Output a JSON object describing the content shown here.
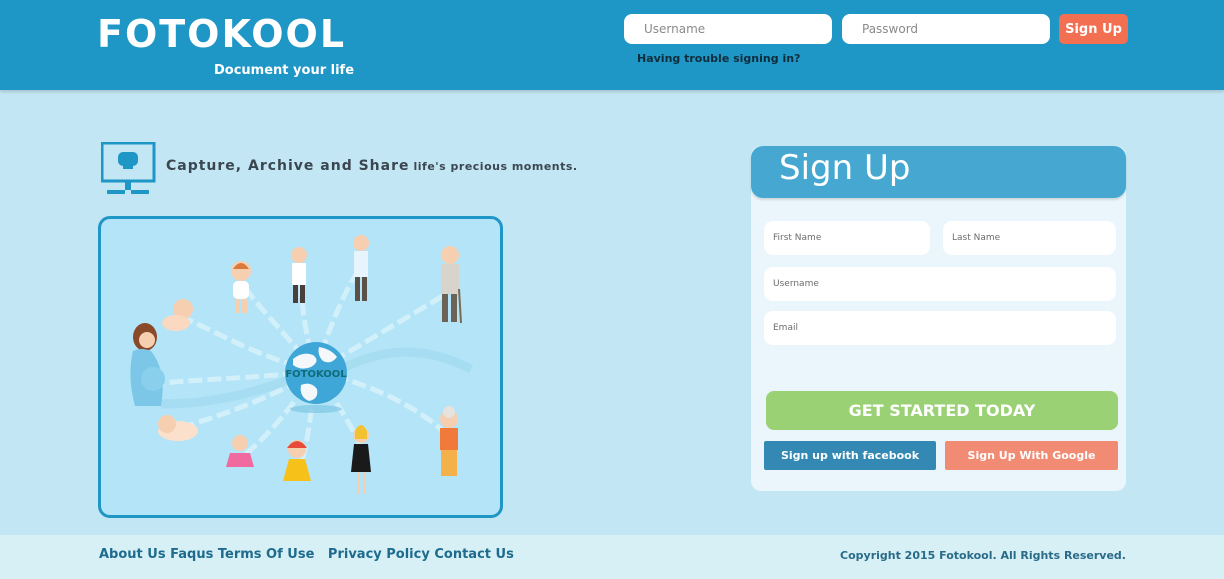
{
  "header": {
    "logo": "FOTOKOOL",
    "tagline": "Document your life",
    "username_placeholder": "Username",
    "password_placeholder": "Password",
    "signup_label": "Sign Up",
    "trouble_link": "Having trouble signing in?"
  },
  "intro": {
    "headline": "Capture, Archive and Share",
    "subline": "life's precious moments."
  },
  "illustration": {
    "globe_label": "FOTOKOOL"
  },
  "signup_form": {
    "title": "Sign Up",
    "first_name_placeholder": "First Name",
    "last_name_placeholder": "Last Name",
    "username_placeholder": "Username",
    "email_placeholder": "Email",
    "get_started_label": "GET STARTED TODAY",
    "facebook_label": "Sign up with facebook",
    "google_label": "Sign Up With Google"
  },
  "footer": {
    "links": [
      "About Us",
      "Faqus",
      "Terms Of Use",
      "Privacy Policy",
      "Contact Us"
    ],
    "copyright": "Copyright 2015 Fotokool. All Rights Reserved."
  },
  "colors": {
    "header_bg": "#1e96c6",
    "page_bg": "#c3e6f4",
    "accent_signup": "#f26f51",
    "get_started": "#9bd175",
    "facebook": "#3389b3",
    "google": "#f28b73"
  }
}
